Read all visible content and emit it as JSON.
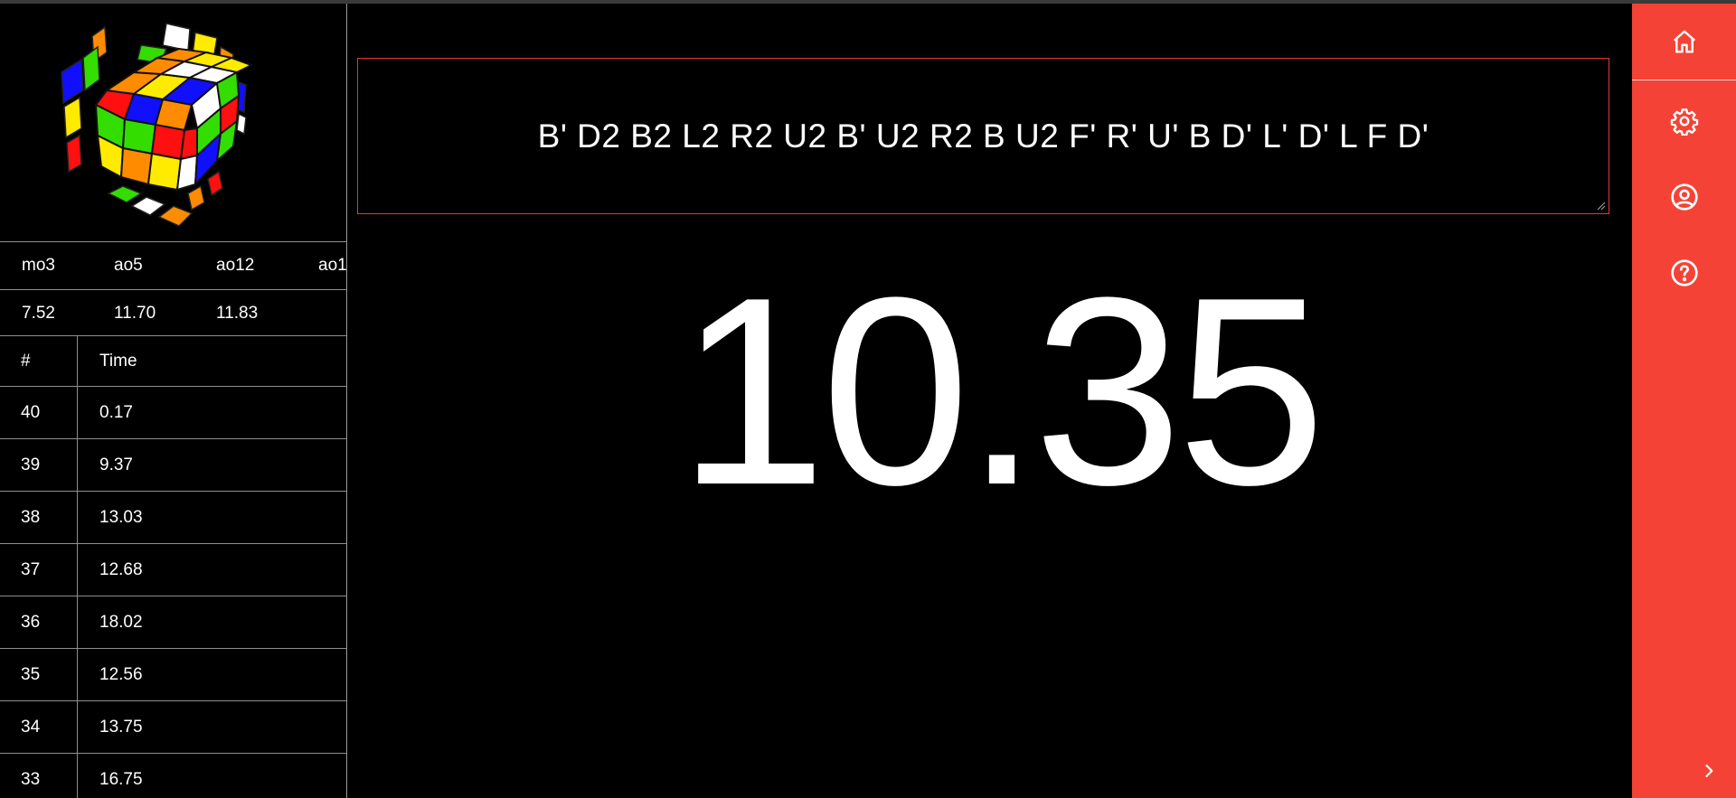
{
  "scramble": "B' D2 B2 L2 R2 U2 B' U2 R2 B U2 F' R' U' B D' L' D' L F D'",
  "timer": "10.35",
  "stats": {
    "headers": [
      "mo3",
      "ao5",
      "ao12",
      "ao1"
    ],
    "values": [
      "7.52",
      "11.70",
      "11.83"
    ]
  },
  "solves": {
    "headers": [
      "#",
      "Time"
    ],
    "rows": [
      {
        "num": "40",
        "time": "0.17"
      },
      {
        "num": "39",
        "time": "9.37"
      },
      {
        "num": "38",
        "time": "13.03"
      },
      {
        "num": "37",
        "time": "12.68"
      },
      {
        "num": "36",
        "time": "18.02"
      },
      {
        "num": "35",
        "time": "12.56"
      },
      {
        "num": "34",
        "time": "13.75"
      },
      {
        "num": "33",
        "time": "16.75"
      }
    ]
  },
  "sidebar": {
    "items": [
      {
        "icon": "home-icon"
      },
      {
        "icon": "gear-icon"
      },
      {
        "icon": "user-circle-icon"
      },
      {
        "icon": "help-circle-icon"
      }
    ],
    "expand_icon": "chevron-right-icon"
  },
  "colors": {
    "accent": "#f44336",
    "background": "#000000",
    "text": "#ffffff"
  }
}
